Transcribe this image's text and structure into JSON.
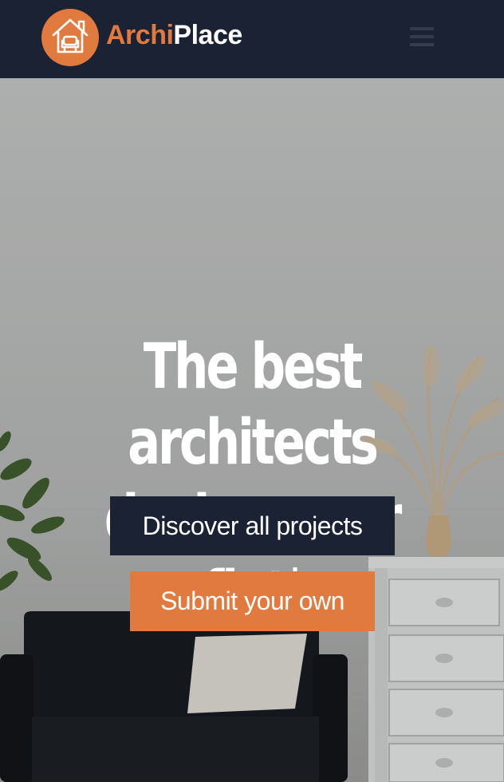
{
  "brand": {
    "name_part1": "Archi",
    "name_part2": "Place",
    "icon": "house-armchair-icon"
  },
  "header": {
    "menu_icon": "hamburger-menu-icon"
  },
  "hero": {
    "headline_line1": "The best architects",
    "headline_line2": "design your flat",
    "caret": "|",
    "primary_button": "Discover all projects",
    "secondary_button": "Submit your own"
  },
  "colors": {
    "accent": "#e07a3f",
    "navy": "#1b2233"
  }
}
